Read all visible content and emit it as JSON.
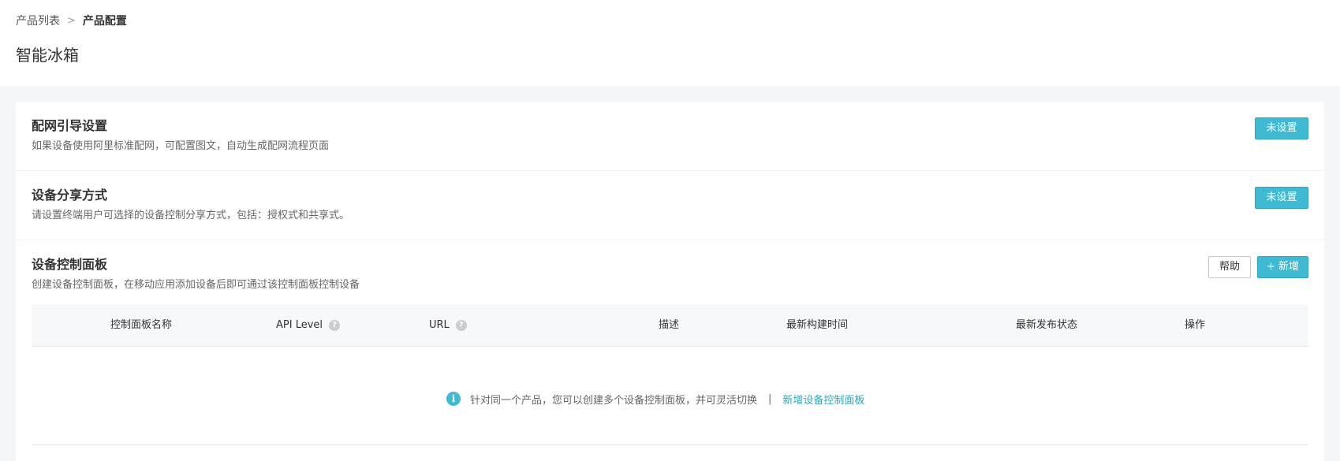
{
  "breadcrumb": {
    "parent": "产品列表",
    "separator": ">",
    "current": "产品配置"
  },
  "page_title": "智能冰箱",
  "sections": {
    "network_guide": {
      "title": "配网引导设置",
      "desc": "如果设备使用阿里标准配网，可配置图文，自动生成配网流程页面",
      "button": "未设置"
    },
    "share_mode": {
      "title": "设备分享方式",
      "desc": "请设置终端用户可选择的设备控制分享方式，包括：授权式和共享式。",
      "button": "未设置"
    },
    "control_panel": {
      "title": "设备控制面板",
      "desc": "创建设备控制面板，在移动应用添加设备后即可通过该控制面板控制设备",
      "help_button": "帮助",
      "add_button": "+ 新增"
    }
  },
  "table": {
    "columns": [
      "控制面板名称",
      "API Level",
      "URL",
      "描述",
      "最新构建时间",
      "最新发布状态",
      "操作"
    ],
    "help_glyph": "?",
    "empty": {
      "info_glyph": "i",
      "message": "针对同一个产品，您可以创建多个设备控制面板，并可灵活切换",
      "separator": "|",
      "link": "新增设备控制面板"
    }
  },
  "colors": {
    "accent": "#3fbad2",
    "link": "#2ea7bf",
    "background": "#f5f6f8"
  },
  "icons": [
    "chevron-right-icon",
    "help-icon",
    "info-icon"
  ]
}
